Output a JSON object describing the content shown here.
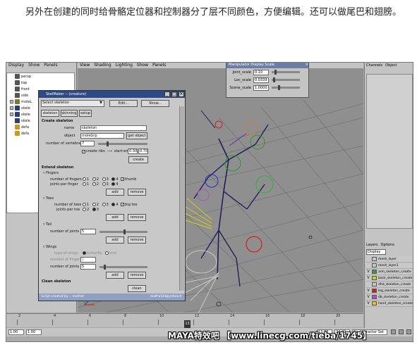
{
  "caption": {
    "text": "另外在创建的同时给骨骼定位器和控制器分了层不同颜色，方便编辑。还可以做尾巴和翅膀。"
  },
  "maya": {
    "outliner_menu": [
      "Display",
      "Show",
      "Panels"
    ],
    "outliner_items": [
      {
        "label": "persp",
        "expander": false,
        "color": "#555555"
      },
      {
        "label": "top",
        "expander": false,
        "color": "#555555"
      },
      {
        "label": "front",
        "expander": false,
        "color": "#555555"
      },
      {
        "label": "side",
        "expander": false,
        "color": "#555555"
      },
      {
        "label": "moleL",
        "expander": true,
        "color": "#7a7a2a"
      },
      {
        "label": "skele",
        "expander": true,
        "color": "#2a3f7a"
      },
      {
        "label": "skele",
        "expander": true,
        "color": "#2a3f7a"
      },
      {
        "label": "skele",
        "expander": false,
        "color": "#2a3f7a"
      },
      {
        "label": "defa",
        "expander": false,
        "color": "#c89a20"
      },
      {
        "label": "defa",
        "expander": false,
        "color": "#c89a20"
      }
    ],
    "viewport_menu": [
      "View",
      "Shading",
      "Lighting",
      "Show",
      "Panels"
    ],
    "manip": {
      "title": "Manipulator Display Scale",
      "rows": [
        {
          "label": "Joint_scale",
          "value": "0.10",
          "level": 0.1
        },
        {
          "label": "Loc_scale",
          "value": "0.0339",
          "level": 0.05
        },
        {
          "label": "Scene_scale",
          "value": "1.0000",
          "level": 0.25
        }
      ]
    },
    "dialog": {
      "title": "SkelMaker -- (creature)",
      "select_value": "Select skeleton",
      "edit_label": "Edit...",
      "show_label": "Show...",
      "tabs": [
        "skeleton",
        "skinning",
        "setup"
      ],
      "create_header": "Create skeleton",
      "name_label": "name",
      "name_value": "skeleton",
      "object_label": "object",
      "object_value": "moleGrp",
      "get_object_label": "get object",
      "vertebrae_label": "number of vertebrae",
      "vertebrae_value": "7",
      "ribs_label": "create ribs",
      "start_end_label": "start-end",
      "start_value": "0.30",
      "end_value": "0.70",
      "create_button": "create",
      "extend_header": "Extend skeleton",
      "fingers": {
        "title": "Fingers",
        "num_label": "number of fingers",
        "joints_label": "joints per finger",
        "options": [
          "1",
          "2",
          "3",
          "4"
        ],
        "num_selected": "4",
        "joints_selected": "4",
        "extra_label": "thumb"
      },
      "toes": {
        "title": "Toes",
        "num_label": "number of toes",
        "joints_label": "joints per toe",
        "options": [
          "1",
          "2",
          "3",
          "4"
        ],
        "joint_options": [
          "2",
          "3"
        ],
        "num_selected": "4",
        "joints_selected": "3",
        "extra_label": "big toe"
      },
      "tail": {
        "title": "Tail",
        "joints_label": "number of joints",
        "joints_value": "5"
      },
      "wings": {
        "title": "Wings",
        "type_label": "type of wings",
        "type_options": [
          "butterfly",
          "bird"
        ],
        "fingers_label": "number of fingers",
        "fingers_value": "1",
        "joints_label": "number of joints",
        "joints_value": "5"
      },
      "add_label": "add",
      "remove_label": "remove",
      "clean_header": "Clean skeleton",
      "clean_button": "clean",
      "footer_left": "Script created by :: malfrat",
      "footer_right": "malfrat3d@yahoo.fr"
    },
    "right_panel": {
      "tabs": [
        "Channels",
        "Object"
      ],
      "layer_tabs": [
        "Layers",
        "Options"
      ],
      "layer_select": "Display",
      "layers": [
        {
          "visible": "",
          "name": "mesh_layer",
          "color": "#c8c8c8"
        },
        {
          "visible": "",
          "name": "mesh_layer1",
          "color": "#c8c8c8"
        },
        {
          "visible": "V",
          "name": "arm_skeleton_create",
          "color": "#3a9a3a"
        },
        {
          "visible": "V",
          "name": "back_skeleton_create",
          "color": "#c8d020"
        },
        {
          "visible": "",
          "name": "dhd_skeleton_create",
          "color": "#c8c8c8"
        },
        {
          "visible": "V",
          "name": "leg_skeleton_create",
          "color": "#cc2020"
        },
        {
          "visible": "V",
          "name": "db_skeleton_create",
          "color": "#b050c0"
        },
        {
          "visible": "V",
          "name": "hand_skeleton_create",
          "color": "#e8c020"
        }
      ]
    },
    "timeline": {
      "ticks": [
        "2",
        "4",
        "6",
        "8",
        "10",
        "12",
        "14",
        "16",
        "18",
        "20"
      ],
      "current_frame": "13"
    },
    "range": {
      "start": "1.00",
      "start2": "1.00",
      "end_field": "13.00",
      "end_field2": "24.00",
      "character_set": "No Character Set"
    }
  },
  "watermark": "MAYA特效吧 【www.linecg.com/tieba/1745】"
}
